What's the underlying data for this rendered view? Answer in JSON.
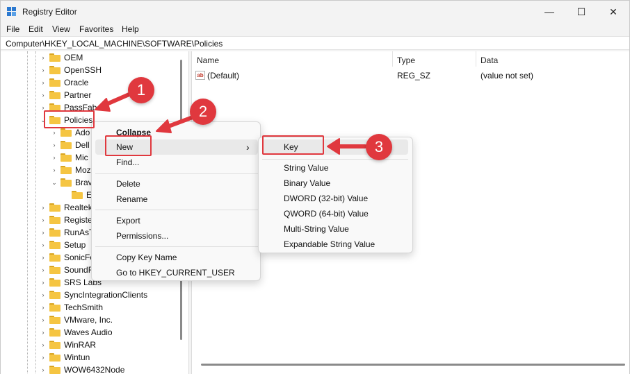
{
  "window": {
    "title": "Registry Editor"
  },
  "title_buttons": {
    "minimize": "—",
    "maximize": "☐",
    "close": "✕"
  },
  "menu": [
    "File",
    "Edit",
    "View",
    "Favorites",
    "Help"
  ],
  "address": "Computer\\HKEY_LOCAL_MACHINE\\SOFTWARE\\Policies",
  "tree": {
    "top_items": [
      "OEM",
      "OpenSSH",
      "Oracle",
      "Partner",
      "PassFab"
    ],
    "selected": "Policies",
    "children": [
      "Ado",
      "Dell",
      "Mic",
      "Moz",
      "Brav"
    ],
    "grandchild": "E",
    "bottom_items": [
      "Realtek",
      "Registe",
      "RunAsT",
      "Setup",
      "SonicFo",
      "SoundR",
      "SRS Labs",
      "SyncIntegrationClients",
      "TechSmith",
      "VMware, Inc.",
      "Waves Audio",
      "WinRAR",
      "Wintun",
      "WOW6432Node"
    ]
  },
  "columns": {
    "name": "Name",
    "type": "Type",
    "data": "Data"
  },
  "entries": [
    {
      "icon": "ab",
      "name": "(Default)",
      "type": "REG_SZ",
      "data": "(value not set)"
    }
  ],
  "context_menu": {
    "collapse": "Collapse",
    "new": "New",
    "submenu_arrow": "›",
    "find": "Find...",
    "delete": "Delete",
    "rename": "Rename",
    "export": "Export",
    "permissions": "Permissions...",
    "copy_key_name": "Copy Key Name",
    "goto": "Go to HKEY_CURRENT_USER"
  },
  "new_submenu": {
    "key": "Key",
    "string_value": "String Value",
    "binary_value": "Binary Value",
    "dword": "DWORD (32-bit) Value",
    "qword": "QWORD (64-bit) Value",
    "multi_string": "Multi-String Value",
    "expandable_string": "Expandable String Value"
  },
  "callouts": {
    "one": "1",
    "two": "2",
    "three": "3"
  },
  "colors": {
    "accent_red": "#e0383e",
    "folder": "#f5c542",
    "app_icon": "#2b79d0"
  }
}
